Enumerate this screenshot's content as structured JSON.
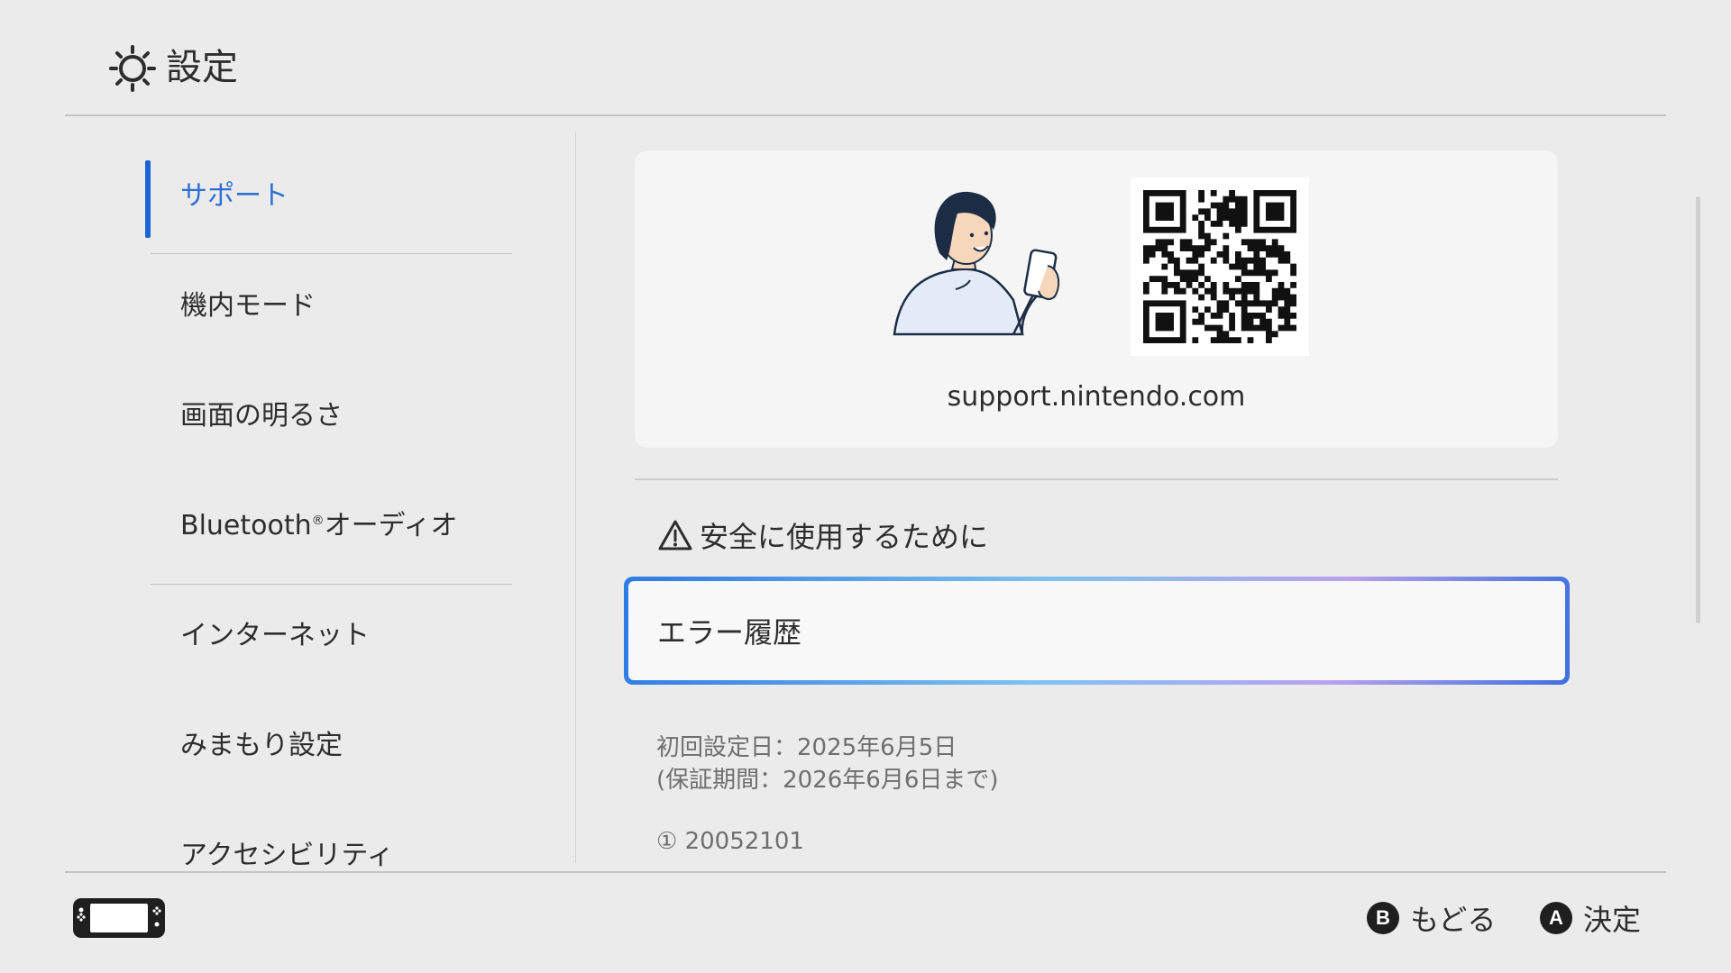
{
  "header": {
    "title": "設定",
    "icon": "sun-gear-icon"
  },
  "sidebar": {
    "items": [
      {
        "label": "サポート",
        "selected": true
      },
      {
        "label": "機内モード"
      },
      {
        "label": "画面の明るさ"
      },
      {
        "label": "Bluetooth",
        "mark": "®",
        "suffix": "オーディオ"
      },
      {
        "label": "インターネット"
      },
      {
        "label": "みまもり設定"
      },
      {
        "label": "アクセシビリティ"
      }
    ]
  },
  "content": {
    "support_card": {
      "url": "support.nintendo.com"
    },
    "safety_label": "安全に使用するために",
    "error_history_label": "エラー履歴",
    "info": {
      "setup_date": "初回設定日：2025年6月5日",
      "warranty": "(保証期間：2026年6月6日まで)",
      "serial_marker": "①",
      "serial": "20052101"
    }
  },
  "footer": {
    "back_key": "B",
    "back_label": "もどる",
    "confirm_key": "A",
    "confirm_label": "決定"
  },
  "colors": {
    "accent": "#1b64d8",
    "background": "#ebebeb",
    "card": "#f5f5f5"
  }
}
